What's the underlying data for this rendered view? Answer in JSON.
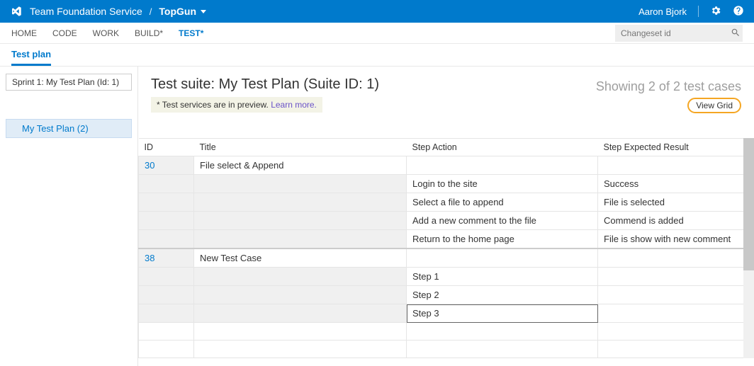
{
  "topbar": {
    "service_name": "Team Foundation Service",
    "separator": "/",
    "project": "TopGun",
    "user": "Aaron Bjork"
  },
  "hubnav": {
    "home": "HOME",
    "code": "CODE",
    "work": "WORK",
    "build": "BUILD*",
    "test": "TEST*",
    "changeset_placeholder": "Changeset id"
  },
  "subnav": {
    "testplan": "Test plan"
  },
  "sidebar": {
    "plan_selector": "Sprint 1: My Test Plan (Id: 1)",
    "plan_item": "My Test Plan (2)"
  },
  "content": {
    "suite_title": "Test suite: My Test Plan (Suite ID: 1)",
    "preview_prefix": " * Test services are in preview. ",
    "preview_link": "Learn more.",
    "showing": "Showing 2 of 2 test cases",
    "view_label": "View",
    "view_value": "Grid"
  },
  "grid": {
    "headers": {
      "id": "ID",
      "title": "Title",
      "action": "Step Action",
      "expected": "Step Expected Result"
    },
    "rows": [
      {
        "id": "30",
        "title": "File select & Append",
        "action": "",
        "expected": "",
        "id_is_link": true,
        "shaded": false
      },
      {
        "id": "",
        "title": "",
        "action": "Login to the site",
        "expected": "Success",
        "shaded": true
      },
      {
        "id": "",
        "title": "",
        "action": "Select a file to append",
        "expected": "File is selected",
        "shaded": true
      },
      {
        "id": "",
        "title": "",
        "action": "Add a new comment to the file",
        "expected": "Commend is added",
        "shaded": true
      },
      {
        "id": "",
        "title": "",
        "action": "Return to the home page",
        "expected": "File is show with new comment",
        "shaded": true
      },
      {
        "id": "38",
        "title": "New Test Case",
        "action": "",
        "expected": "",
        "id_is_link": true,
        "shaded": false,
        "divider": true
      },
      {
        "id": "",
        "title": "",
        "action": "Step 1",
        "expected": "",
        "shaded": true
      },
      {
        "id": "",
        "title": "",
        "action": "Step 2",
        "expected": "",
        "shaded": true
      },
      {
        "id": "",
        "title": "",
        "action": "Step 3",
        "expected": "",
        "shaded": true,
        "editing": true
      },
      {
        "id": "",
        "title": "",
        "action": "",
        "expected": "",
        "shaded": false
      },
      {
        "id": "",
        "title": "",
        "action": "",
        "expected": "",
        "shaded": false
      }
    ]
  }
}
